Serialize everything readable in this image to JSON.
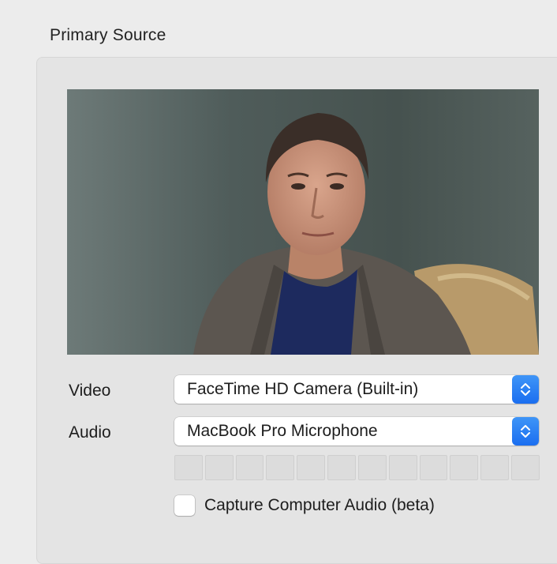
{
  "section": {
    "title": "Primary Source"
  },
  "video": {
    "label": "Video",
    "selected": "FaceTime HD Camera (Built-in)"
  },
  "audio": {
    "label": "Audio",
    "selected": "MacBook Pro Microphone",
    "meter_segments": 12,
    "meter_level": 0
  },
  "capture_audio": {
    "label": "Capture Computer Audio (beta)",
    "checked": false
  },
  "colors": {
    "accent": "#1b6ef0",
    "background": "#ececec"
  }
}
